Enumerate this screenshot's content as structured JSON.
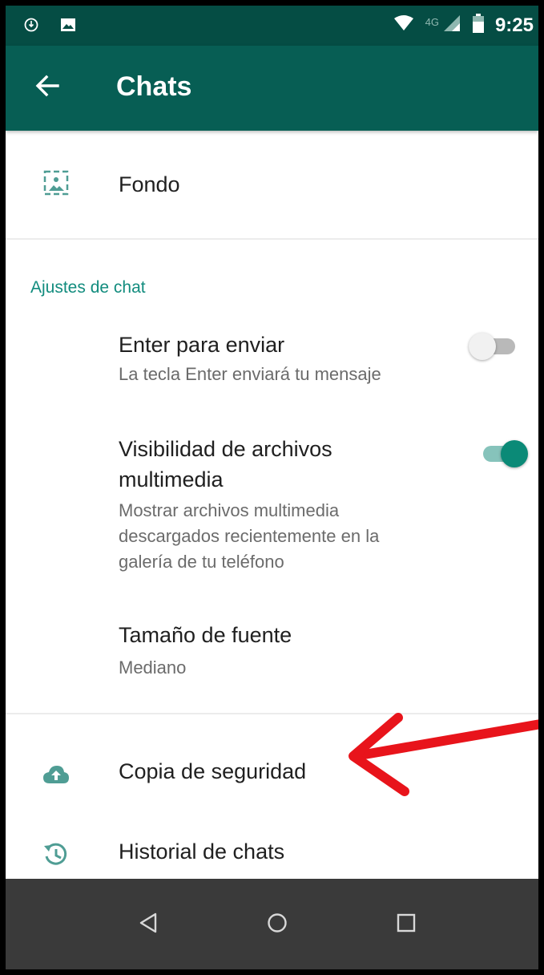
{
  "status_bar": {
    "time": "9:25",
    "network": "4G",
    "icons": [
      "data-saver-icon",
      "image-icon",
      "wifi-icon",
      "cell-signal-icon",
      "battery-icon"
    ]
  },
  "app_bar": {
    "title": "Chats",
    "back_icon": "arrow-back-icon",
    "background": "#075e54",
    "status_background": "#054d44"
  },
  "items": {
    "wallpaper": {
      "title": "Fondo",
      "icon": "wallpaper-icon"
    },
    "chat_settings_header": "Ajustes de chat",
    "enter_to_send": {
      "title": "Enter para enviar",
      "subtitle": "La tecla Enter enviará tu mensaje",
      "enabled": false
    },
    "media_visibility": {
      "title_line1": "Visibilidad de archivos",
      "title_line2": "multimedia",
      "subtitle_line1": "Mostrar archivos multimedia",
      "subtitle_line2": "descargados recientemente en la",
      "subtitle_line3": "galería de tu teléfono",
      "enabled": true
    },
    "font_size": {
      "title": "Tamaño de fuente",
      "subtitle": "Mediano"
    },
    "backup": {
      "title": "Copia de seguridad",
      "icon": "cloud-upload-icon"
    },
    "history": {
      "title": "Historial de chats",
      "icon": "history-icon"
    }
  },
  "annotation": {
    "type": "arrow",
    "color": "#e8141b",
    "points_to": "backup"
  },
  "nav_bar": {
    "icons": [
      "nav-back-icon",
      "nav-home-icon",
      "nav-recents-icon"
    ]
  },
  "colors": {
    "accent": "#128c7e",
    "switch_on": "#0b8a77"
  }
}
